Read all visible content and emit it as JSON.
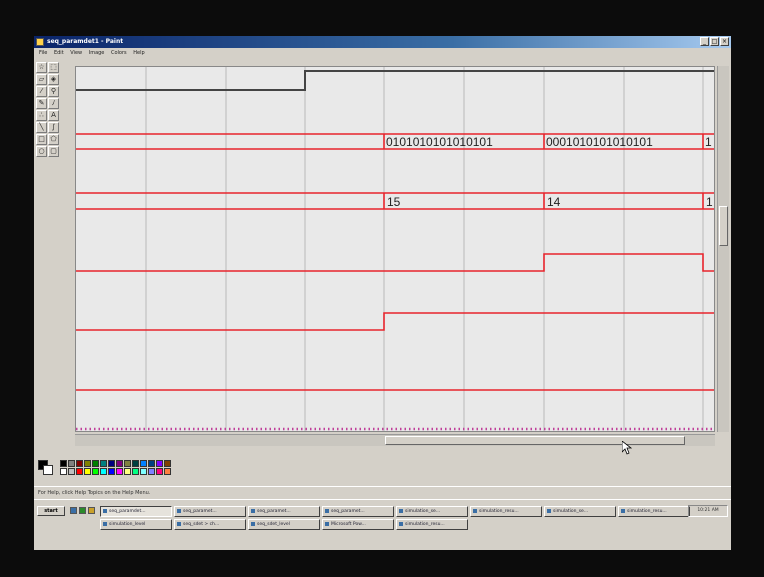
{
  "window": {
    "title": "seq_paramdet1 - Paint",
    "controls": [
      "_",
      "□",
      "×"
    ]
  },
  "menu": [
    "File",
    "Edit",
    "View",
    "Image",
    "Colors",
    "Help"
  ],
  "toolbox": {
    "tools": [
      "free-select",
      "select",
      "eraser",
      "fill",
      "pick-color",
      "magnifier",
      "pencil",
      "brush",
      "airbrush",
      "text",
      "line",
      "curve",
      "rectangle",
      "polygon",
      "ellipse",
      "rounded-rectangle"
    ]
  },
  "waveform": {
    "bus_a_values": [
      "0101010101010101",
      "0001010101010101",
      "1"
    ],
    "bus_b_values": [
      "15",
      "14",
      "1"
    ],
    "colors": {
      "canvas": "#e9e9e9",
      "signal": "#e8242c",
      "clock_signal": "#444444",
      "gridline": "#b9b9b9",
      "dotted_marker": "#c0409a"
    }
  },
  "palette": {
    "colors": [
      "#000000",
      "#808080",
      "#800000",
      "#808000",
      "#008000",
      "#008080",
      "#000080",
      "#800080",
      "#808040",
      "#004040",
      "#0080ff",
      "#004080",
      "#8000ff",
      "#804000",
      "#ffffff",
      "#c0c0c0",
      "#ff0000",
      "#ffff00",
      "#00ff00",
      "#00ffff",
      "#0000ff",
      "#ff00ff",
      "#ffff80",
      "#00ff80",
      "#80ffff",
      "#8080ff",
      "#ff0080",
      "#ff8040"
    ]
  },
  "statusbar": {
    "text": "For Help, click Help Topics on the Help Menu."
  },
  "taskbar": {
    "start_label": "start",
    "clock": "10:21 AM",
    "tasks_row1": [
      "seq_paramdet...",
      "seq_paramet...",
      "seq_paramet...",
      "seq_paramet...",
      "simulation_se...",
      "simulation_resu...",
      "simulation_se...",
      "simulation_resu..."
    ],
    "tasks_row2": [
      "simulation_level",
      "seq_sdet > ch...",
      "seq_sdet_level",
      "Microsoft Pow...",
      "simulation_resu..."
    ]
  }
}
